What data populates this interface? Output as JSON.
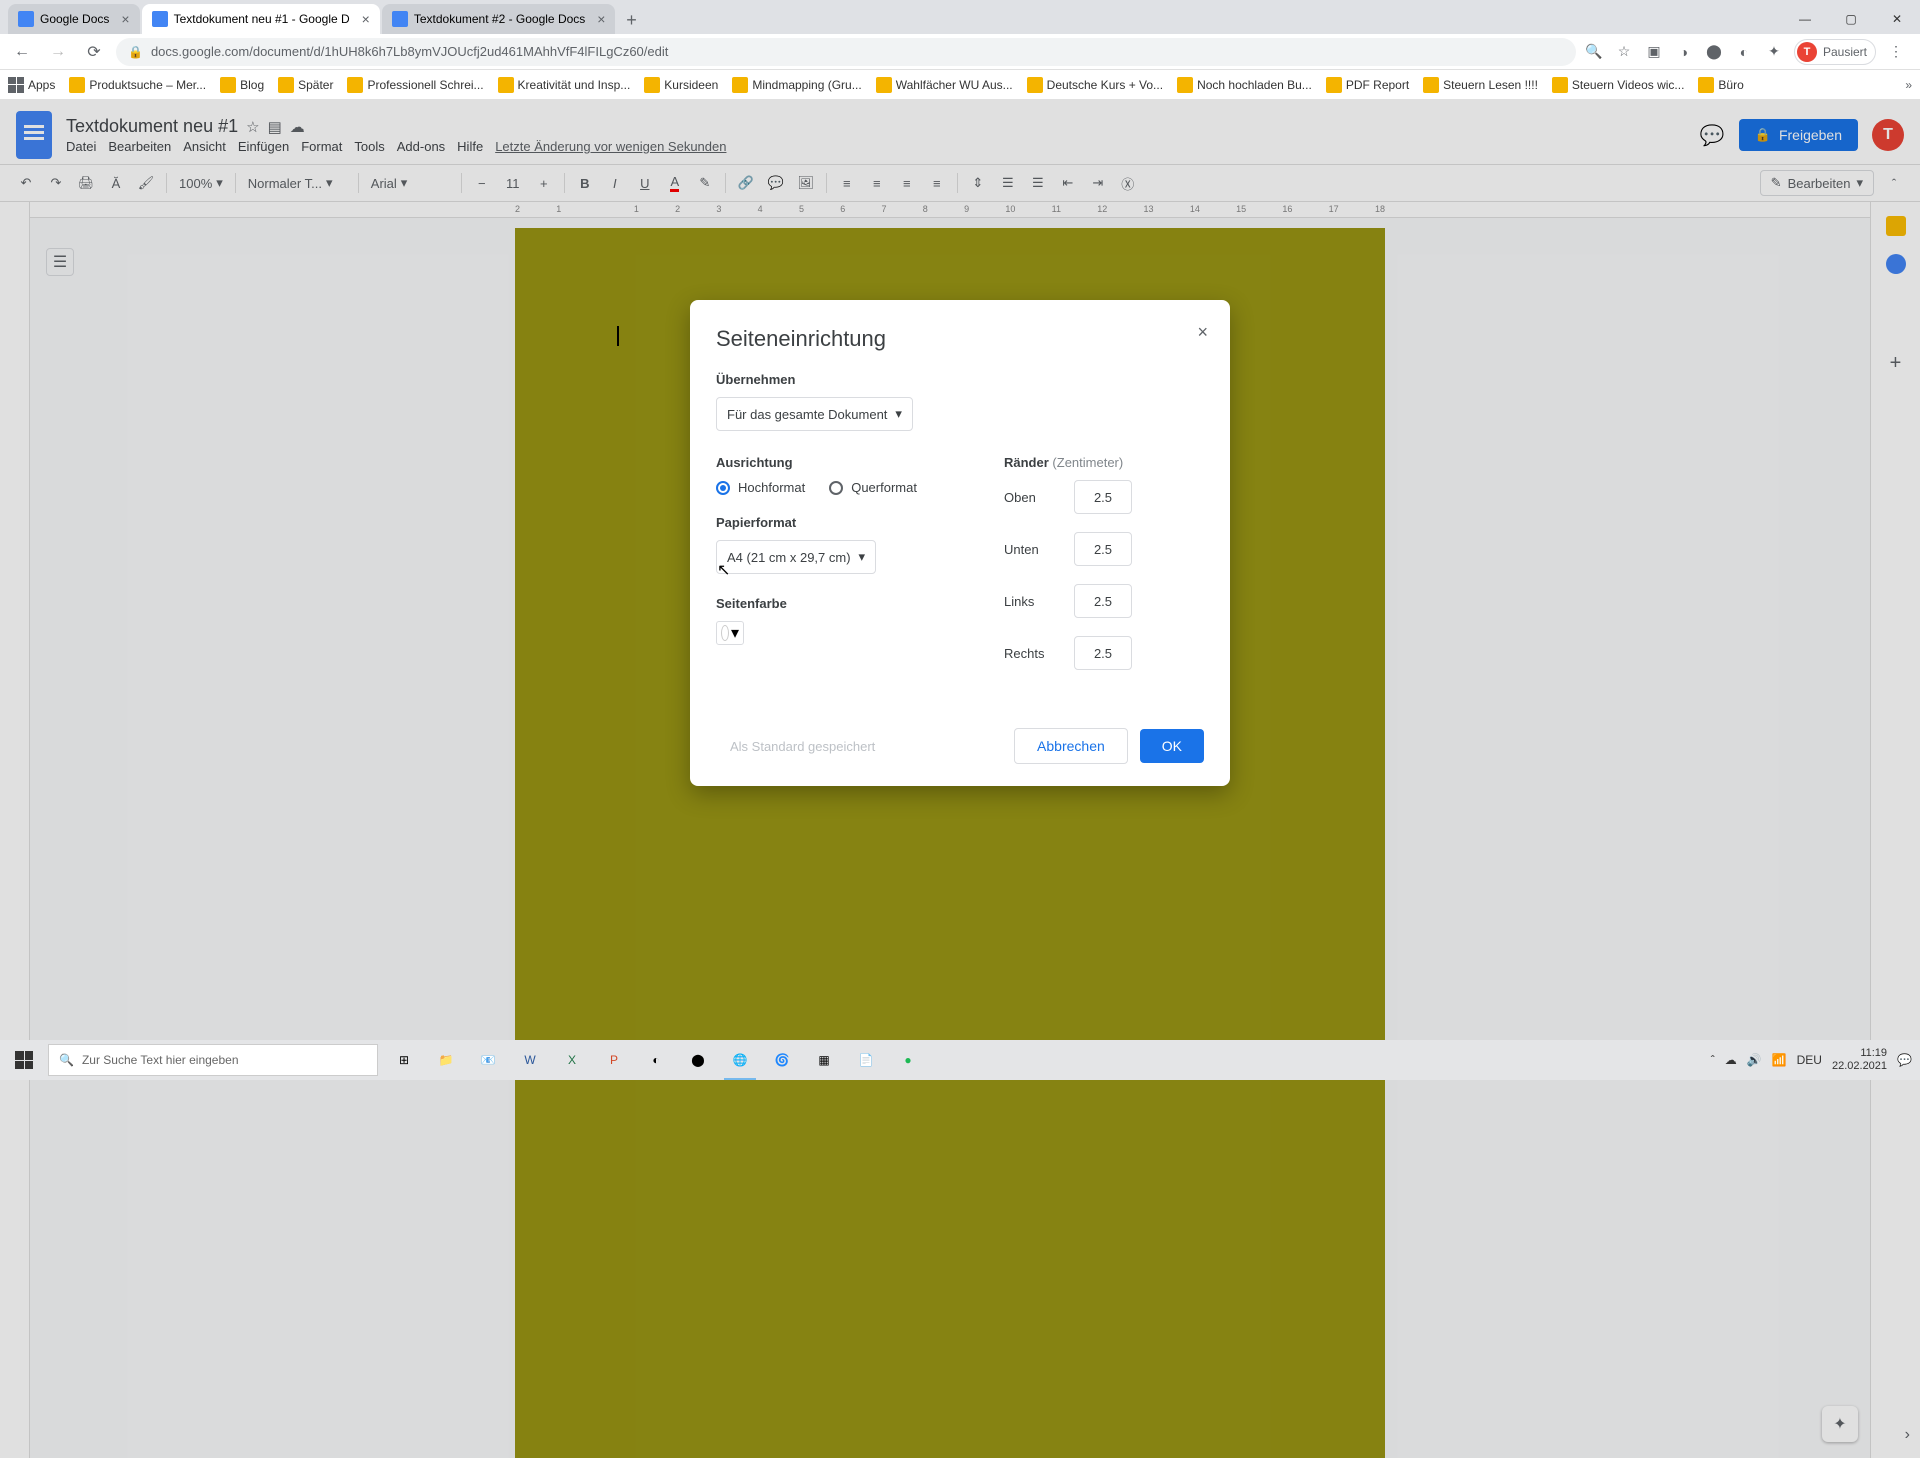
{
  "browser": {
    "tabs": [
      {
        "title": "Google Docs",
        "active": false
      },
      {
        "title": "Textdokument neu #1 - Google D",
        "active": true
      },
      {
        "title": "Textdokument #2 - Google Docs",
        "active": false
      }
    ],
    "url": "docs.google.com/document/d/1hUH8k6h7Lb8ymVJOUcfj2ud461MAhhVfF4lFILgCz60/edit",
    "avatar_letter": "T",
    "paused": "Pausiert"
  },
  "bookmarks": {
    "apps": "Apps",
    "items": [
      "Produktsuche – Mer...",
      "Blog",
      "Später",
      "Professionell Schrei...",
      "Kreativität und Insp...",
      "Kursideen",
      "Mindmapping  (Gru...",
      "Wahlfächer WU Aus...",
      "Deutsche Kurs + Vo...",
      "Noch hochladen Bu...",
      "PDF Report",
      "Steuern Lesen !!!!",
      "Steuern Videos wic...",
      "Büro"
    ]
  },
  "docs": {
    "title": "Textdokument neu #1",
    "menus": [
      "Datei",
      "Bearbeiten",
      "Ansicht",
      "Einfügen",
      "Format",
      "Tools",
      "Add-ons",
      "Hilfe"
    ],
    "last_change": "Letzte Änderung vor wenigen Sekunden",
    "share": "Freigeben",
    "avatar": "T"
  },
  "toolbar": {
    "zoom": "100%",
    "style": "Normaler T...",
    "font": "Arial",
    "size": "11",
    "edit_mode": "Bearbeiten"
  },
  "ruler": {
    "h": [
      "2",
      "1",
      "",
      "1",
      "2",
      "3",
      "4",
      "5",
      "6",
      "7",
      "8",
      "9",
      "10",
      "11",
      "12",
      "13",
      "14",
      "15",
      "16",
      "17",
      "18"
    ]
  },
  "dialog": {
    "title": "Seiteneinrichtung",
    "apply_label": "Übernehmen",
    "apply_value": "Für das gesamte Dokument",
    "orientation_label": "Ausrichtung",
    "portrait": "Hochformat",
    "landscape": "Querformat",
    "paper_label": "Papierformat",
    "paper_value": "A4 (21 cm x 29,7 cm)",
    "color_label": "Seitenfarbe",
    "margins_label": "Ränder",
    "margins_unit": "(Zentimeter)",
    "top": "Oben",
    "top_v": "2.5",
    "bottom": "Unten",
    "bottom_v": "2.5",
    "left": "Links",
    "left_v": "2.5",
    "right": "Rechts",
    "right_v": "2.5",
    "saved": "Als Standard gespeichert",
    "cancel": "Abbrechen",
    "ok": "OK"
  },
  "taskbar": {
    "search": "Zur Suche Text hier eingeben",
    "lang": "DEU",
    "time": "11:19",
    "date": "22.02.2021"
  }
}
